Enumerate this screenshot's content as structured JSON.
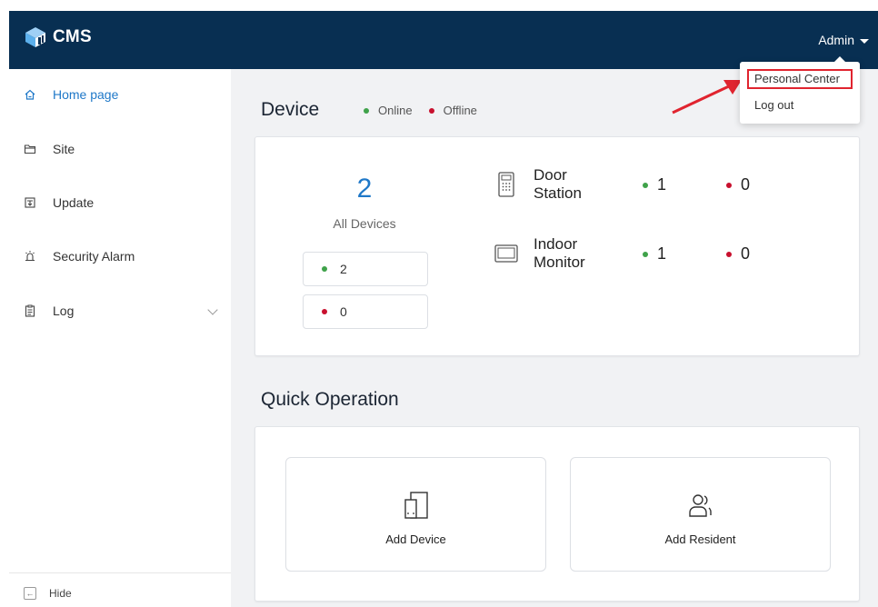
{
  "header": {
    "app_name": "CMS",
    "user_label": "Admin",
    "brand_color": "#082f52"
  },
  "user_menu": {
    "items": [
      {
        "label": "Personal Center",
        "highlighted": true
      },
      {
        "label": "Log out"
      }
    ]
  },
  "sidebar": {
    "items": [
      {
        "label": "Home page",
        "icon": "home-icon",
        "active": true
      },
      {
        "label": "Site",
        "icon": "folder-icon"
      },
      {
        "label": "Update",
        "icon": "update-icon"
      },
      {
        "label": "Security Alarm",
        "icon": "alarm-icon"
      },
      {
        "label": "Log",
        "icon": "clipboard-icon",
        "expandable": true
      }
    ],
    "hide_label": "Hide"
  },
  "device": {
    "title": "Device",
    "legend_online": "Online",
    "legend_offline": "Offline",
    "total_count": "2",
    "total_label": "All Devices",
    "online_count": "2",
    "offline_count": "0",
    "types": [
      {
        "name_line1": "Door",
        "name_line2": "Station",
        "icon": "door-station-icon",
        "online": "1",
        "offline": "0"
      },
      {
        "name_line1": "Indoor",
        "name_line2": "Monitor",
        "icon": "indoor-monitor-icon",
        "online": "1",
        "offline": "0"
      }
    ]
  },
  "quick_operation": {
    "title": "Quick Operation",
    "actions": [
      {
        "label": "Add Device",
        "icon": "add-device-icon"
      },
      {
        "label": "Add Resident",
        "icon": "add-resident-icon"
      }
    ]
  },
  "colors": {
    "accent": "#1f78c8",
    "online": "#3fa24a",
    "offline": "#c8102e",
    "highlight": "#e0242f"
  }
}
